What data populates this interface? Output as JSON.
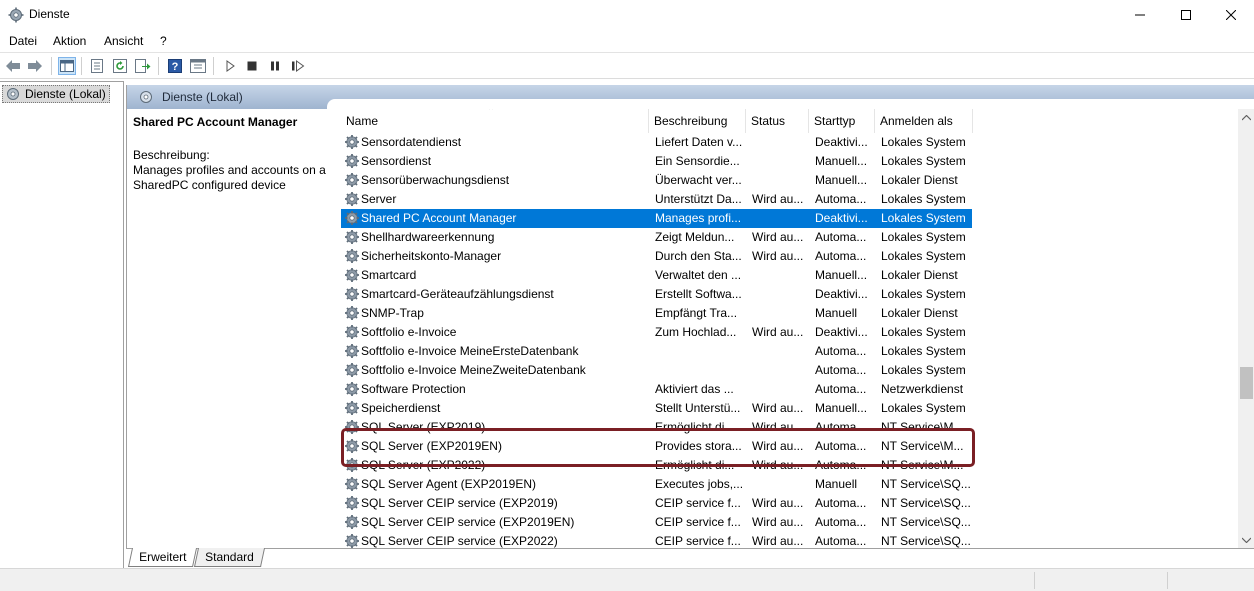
{
  "window": {
    "title": "Dienste"
  },
  "menu": [
    "Datei",
    "Aktion",
    "Ansicht",
    "?"
  ],
  "tree": {
    "root_label": "Dienste (Lokal)"
  },
  "panel": {
    "header_title": "Dienste (Lokal)"
  },
  "description": {
    "service_name": "Shared PC Account Manager",
    "label": "Beschreibung:",
    "text": "Manages profiles and accounts on a SharedPC configured device"
  },
  "columns": [
    "Name",
    "Beschreibung",
    "Status",
    "Starttyp",
    "Anmelden als"
  ],
  "rows": [
    {
      "name": "Sensordatendienst",
      "desc": "Liefert Daten v...",
      "status": "",
      "start": "Deaktivi...",
      "logon": "Lokales System"
    },
    {
      "name": "Sensordienst",
      "desc": "Ein Sensordie...",
      "status": "",
      "start": "Manuell...",
      "logon": "Lokales System"
    },
    {
      "name": "Sensorüberwachungsdienst",
      "desc": "Überwacht ver...",
      "status": "",
      "start": "Manuell...",
      "logon": "Lokaler Dienst"
    },
    {
      "name": "Server",
      "desc": "Unterstützt Da...",
      "status": "Wird au...",
      "start": "Automa...",
      "logon": "Lokales System"
    },
    {
      "name": "Shared PC Account Manager",
      "desc": "Manages profi...",
      "status": "",
      "start": "Deaktivi...",
      "logon": "Lokales System"
    },
    {
      "name": "Shellhardwareerkennung",
      "desc": "Zeigt Meldun...",
      "status": "Wird au...",
      "start": "Automa...",
      "logon": "Lokales System"
    },
    {
      "name": "Sicherheitskonto-Manager",
      "desc": "Durch den Sta...",
      "status": "Wird au...",
      "start": "Automa...",
      "logon": "Lokales System"
    },
    {
      "name": "Smartcard",
      "desc": "Verwaltet den ...",
      "status": "",
      "start": "Manuell...",
      "logon": "Lokaler Dienst"
    },
    {
      "name": "Smartcard-Geräteaufzählungsdienst",
      "desc": "Erstellt Softwa...",
      "status": "",
      "start": "Deaktivi...",
      "logon": "Lokales System"
    },
    {
      "name": "SNMP-Trap",
      "desc": "Empfängt Tra...",
      "status": "",
      "start": "Manuell",
      "logon": "Lokaler Dienst"
    },
    {
      "name": "Softfolio e-Invoice",
      "desc": "Zum Hochlad...",
      "status": "Wird au...",
      "start": "Deaktivi...",
      "logon": "Lokales System"
    },
    {
      "name": "Softfolio e-Invoice MeineErsteDatenbank",
      "desc": "",
      "status": "",
      "start": "Automa...",
      "logon": "Lokales System"
    },
    {
      "name": "Softfolio e-Invoice MeineZweiteDatenbank",
      "desc": "",
      "status": "",
      "start": "Automa...",
      "logon": "Lokales System"
    },
    {
      "name": "Software Protection",
      "desc": "Aktiviert das ...",
      "status": "",
      "start": "Automa...",
      "logon": "Netzwerkdienst"
    },
    {
      "name": "Speicherdienst",
      "desc": "Stellt Unterstü...",
      "status": "Wird au...",
      "start": "Manuell...",
      "logon": "Lokales System"
    },
    {
      "name": "SQL Server (EXP2019)",
      "desc": "Ermöglicht di...",
      "status": "Wird au...",
      "start": "Automa...",
      "logon": "NT Service\\M..."
    },
    {
      "name": "SQL Server (EXP2019EN)",
      "desc": "Provides stora...",
      "status": "Wird au...",
      "start": "Automa...",
      "logon": "NT Service\\M..."
    },
    {
      "name": "SQL Server (EXP2022)",
      "desc": "Ermöglicht di...",
      "status": "Wird au...",
      "start": "Automa...",
      "logon": "NT Service\\M..."
    },
    {
      "name": "SQL Server Agent (EXP2019EN)",
      "desc": "Executes jobs,...",
      "status": "",
      "start": "Manuell",
      "logon": "NT Service\\SQ..."
    },
    {
      "name": "SQL Server CEIP service (EXP2019)",
      "desc": "CEIP service f...",
      "status": "Wird au...",
      "start": "Automa...",
      "logon": "NT Service\\SQ..."
    },
    {
      "name": "SQL Server CEIP service (EXP2019EN)",
      "desc": "CEIP service f...",
      "status": "Wird au...",
      "start": "Automa...",
      "logon": "NT Service\\SQ..."
    },
    {
      "name": "SQL Server CEIP service (EXP2022)",
      "desc": "CEIP service f...",
      "status": "Wird au...",
      "start": "Automa...",
      "logon": "NT Service\\SQ..."
    }
  ],
  "selected_row": "Shared PC Account Manager",
  "tabs": [
    "Erweitert",
    "Standard"
  ],
  "colors": {
    "selection": "#0078d7",
    "highlight_box": "#7a1f24",
    "panel_header": "#b3c6de"
  },
  "icons": {
    "toolbar": [
      "back-arrow-icon",
      "forward-arrow-icon",
      "show-hide-console-tree-icon",
      "properties-icon",
      "refresh-icon",
      "export-list-icon",
      "help-icon",
      "console-icon",
      "start-service-icon",
      "stop-service-icon",
      "pause-service-icon",
      "restart-service-icon"
    ],
    "row": "gear-icon"
  }
}
